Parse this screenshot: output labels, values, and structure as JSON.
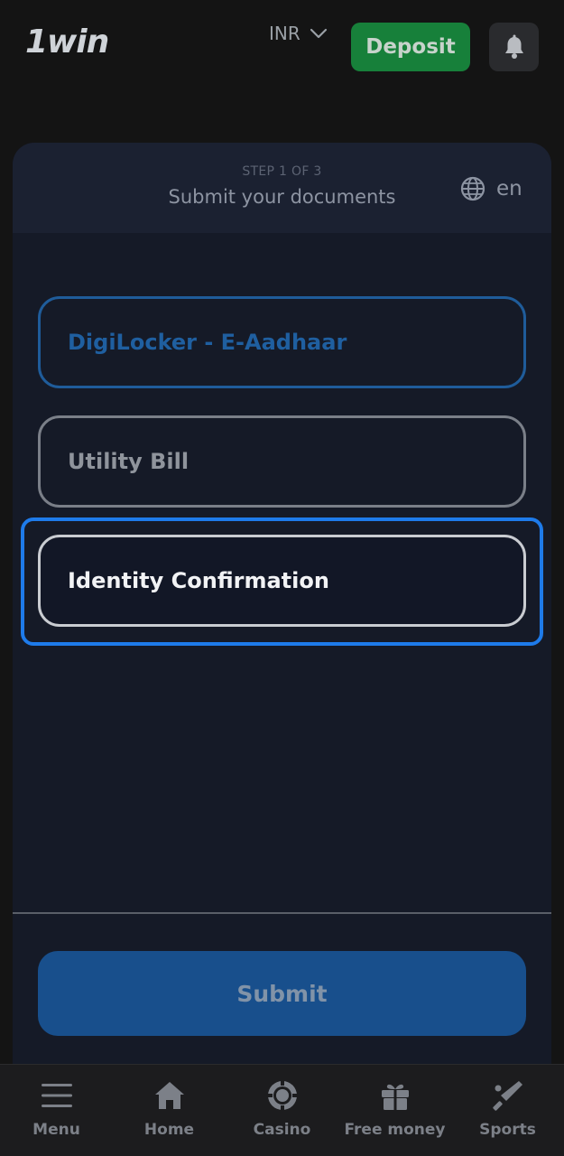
{
  "header": {
    "logo": "1win",
    "currency": "INR",
    "deposit_label": "Deposit"
  },
  "card": {
    "step": "STEP 1 OF 3",
    "title": "Submit your documents",
    "language": "en"
  },
  "options": [
    {
      "label": "DigiLocker - E-Aadhaar"
    },
    {
      "label": "Utility Bill"
    },
    {
      "label": "Identity Confirmation"
    }
  ],
  "submit_label": "Submit",
  "bottom_nav": [
    {
      "label": "Menu",
      "icon": "menu-icon"
    },
    {
      "label": "Home",
      "icon": "home-icon"
    },
    {
      "label": "Casino",
      "icon": "casino-chip-icon"
    },
    {
      "label": "Free money",
      "icon": "gift-icon"
    },
    {
      "label": "Sports",
      "icon": "cricket-bat-icon"
    }
  ],
  "colors": {
    "background": "#141414",
    "deposit_green": "#17803a",
    "accent_blue": "#1e7bea",
    "submit_blue": "#184f8c"
  }
}
